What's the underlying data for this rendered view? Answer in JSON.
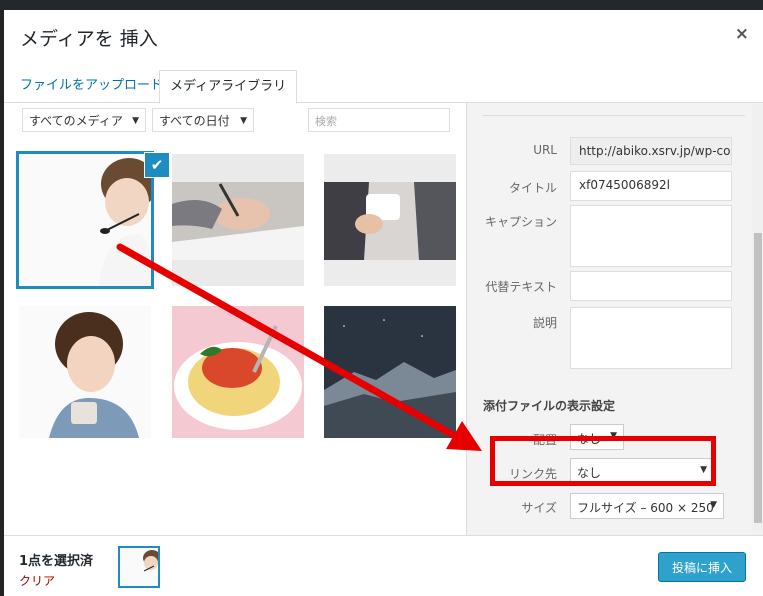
{
  "modal": {
    "title": "メディアを 挿入",
    "close": "×"
  },
  "tabs": {
    "upload": "ファイルをアップロード",
    "library": "メディアライブラリ"
  },
  "filters": {
    "media": "すべてのメディア",
    "date": "すべての日付",
    "search_placeholder": "検索"
  },
  "details": {
    "url_label": "URL",
    "url_value": "http://abiko.xsrv.jp/wp-co",
    "title_label": "タイトル",
    "title_value": "xf0745006892l",
    "caption_label": "キャプション",
    "alt_label": "代替テキスト",
    "description_label": "説明"
  },
  "display": {
    "heading": "添付ファイルの表示設定",
    "align_label": "配置",
    "align_value": "なし",
    "link_label": "リンク先",
    "link_value": "なし",
    "size_label": "サイズ",
    "size_value": "フルサイズ – 600 × 250"
  },
  "footer": {
    "count": "1点を選択済",
    "clear": "クリア",
    "insert": "投稿に挿入"
  },
  "colors": {
    "accent": "#1e8cbe",
    "highlight": "#e60000",
    "button": "#2ea2cc"
  }
}
